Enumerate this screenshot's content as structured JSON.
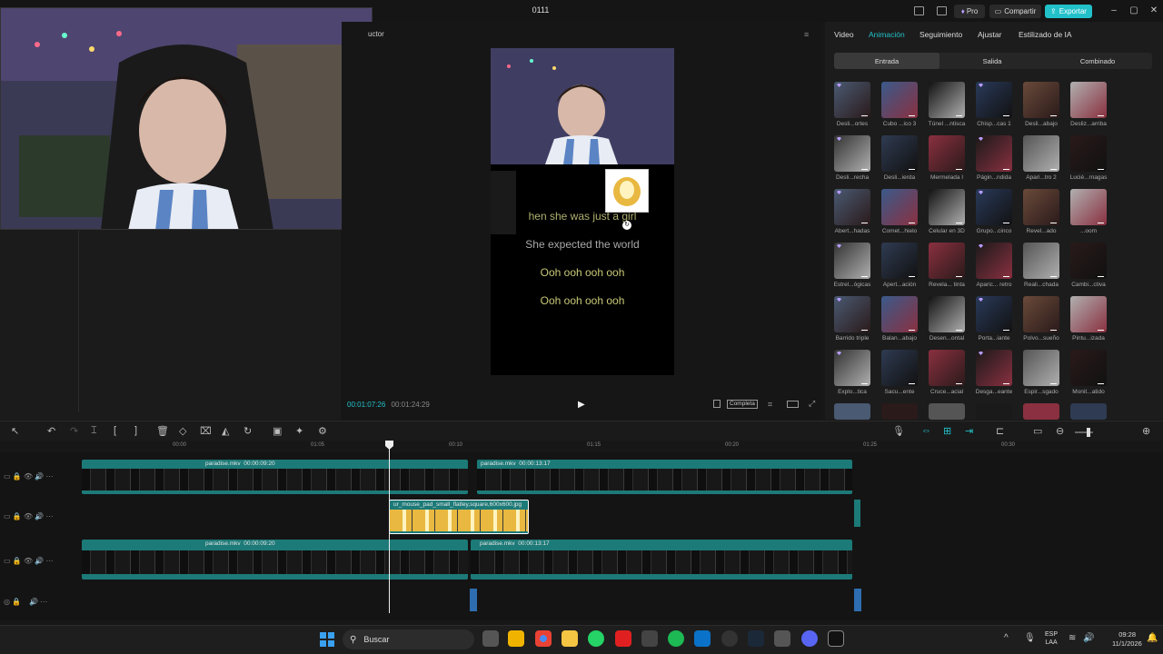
{
  "title_bar": {
    "title": "0111",
    "pro_label": "Pro",
    "share_label": "Compartir",
    "export_label": "Exportar"
  },
  "player": {
    "header_partial": "uctor",
    "timecode_current": "00:01:07:26",
    "timecode_total": "00:01:24:29",
    "view_mode": "Completa",
    "lyrics": [
      "hen she was just a girl",
      "She expected the world",
      "Ooh ooh ooh ooh",
      "Ooh ooh ooh ooh"
    ]
  },
  "inspector": {
    "tabs": [
      "Video",
      "Animación",
      "Seguimiento",
      "Ajustar",
      "Estilizado de IA"
    ],
    "active_tab": "Animación",
    "subtabs": [
      "Entrada",
      "Salida",
      "Combinado"
    ],
    "active_subtab": "Entrada",
    "effects": [
      "Desli...ortes",
      "Cubo ...ico 3",
      "Túnel ...ntisca",
      "Chisp...cas 1",
      "Desli...abajo",
      "Desliz...arriba",
      "Desli...recha",
      "Desli...ierda",
      "Mermelada I",
      "Págin...ndida",
      "Apari...tro 2",
      "Lucié...rnagas",
      "Abert...hadas",
      "Comet...hielo",
      "Celular en 3D",
      "Grupo...cinco",
      "Revel...ado",
      "...oom",
      "Estrel...ógicas",
      "Apert...ación",
      "Revela... tinta",
      "Aparic... retro",
      "Reali...chada",
      "Cambi...ctiva",
      "Barrido triple",
      "Balan...abajo",
      "Desen...ontal",
      "Porta...iante",
      "Polvo...sueño",
      "Pintu...izada",
      "Explo...tica",
      "Sacu...ente",
      "Cruce...acial",
      "Desga...eante",
      "Espir...sgado",
      "Monit...atido"
    ]
  },
  "timeline": {
    "ruler": [
      "00:00",
      "01:05",
      "00:10",
      "01:15",
      "00:20",
      "01:25",
      "00:30"
    ],
    "clips": [
      {
        "name": "paradise.mkv",
        "dur": "00:00:09:20"
      },
      {
        "name": "paradise.mkv",
        "dur": "00:00:13:17"
      },
      {
        "name": "ur_mouse_pad_small_flatley,square,600x600.jpg"
      },
      {
        "name": "paradise.mkv",
        "dur": "00:00:09:20"
      },
      {
        "name": "paradise.mkv",
        "dur": "00:00:13:17"
      }
    ]
  },
  "taskbar": {
    "search_label": "Buscar",
    "lang": "ESP",
    "lang2": "LAA",
    "time": "09:28",
    "date": "11/1/2026"
  },
  "colors": {
    "accent": "#22c1c9",
    "clip": "#1c7a78",
    "lyric": "#c8c878"
  }
}
